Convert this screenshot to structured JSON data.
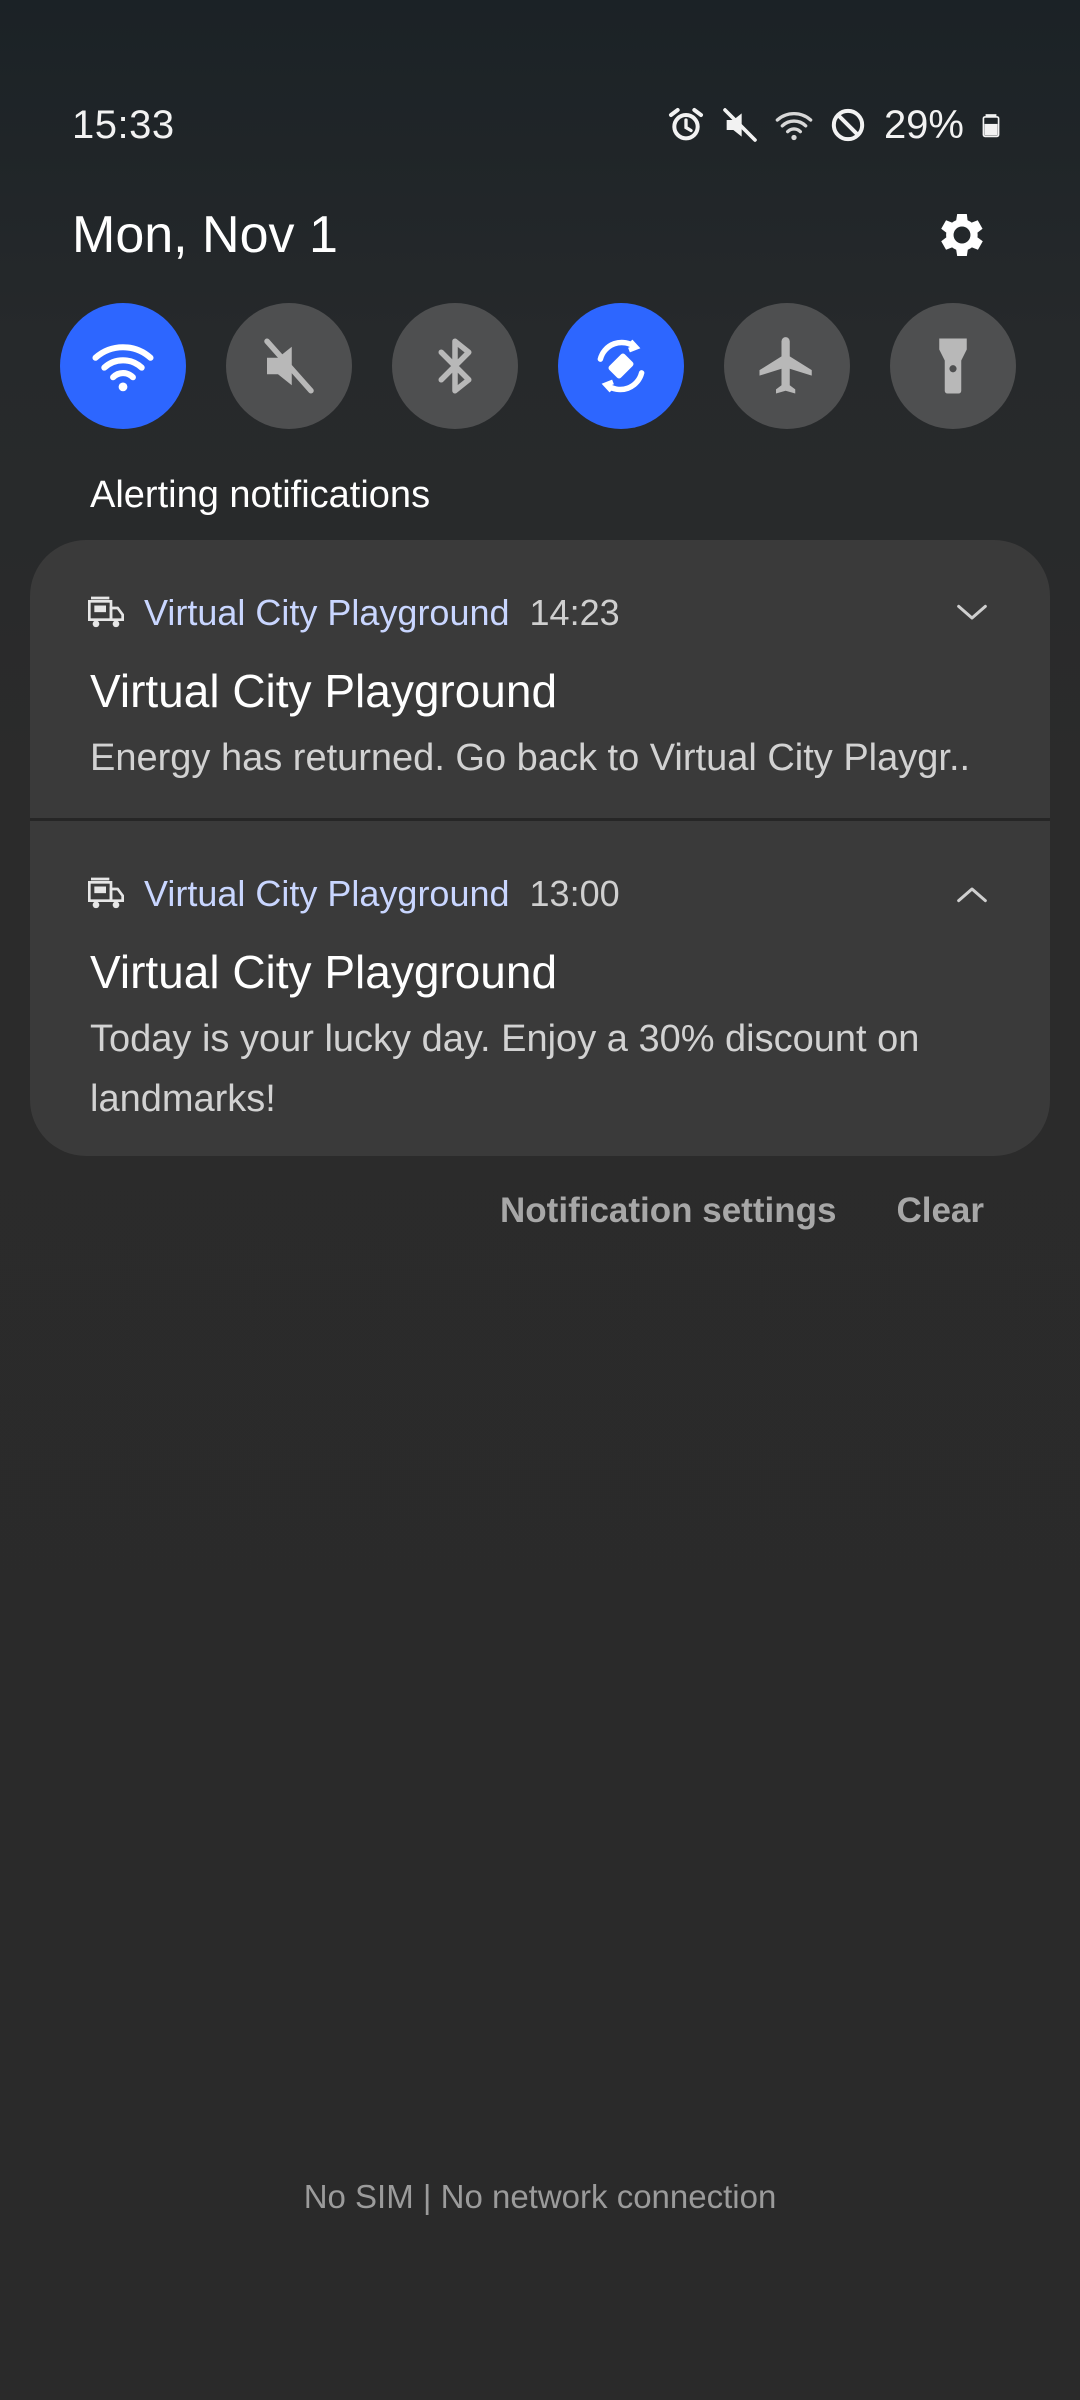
{
  "status_bar": {
    "time": "15:33",
    "battery_percent": "29%",
    "icons": [
      "alarm-icon",
      "mute-icon",
      "wifi-icon",
      "do-not-disturb-icon",
      "battery-icon"
    ]
  },
  "header": {
    "date": "Mon, Nov 1",
    "settings_icon": "gear-icon"
  },
  "quick_settings": [
    {
      "name": "wifi",
      "icon": "wifi-icon",
      "active": true
    },
    {
      "name": "sound",
      "icon": "mute-icon",
      "active": false
    },
    {
      "name": "bluetooth",
      "icon": "bluetooth-icon",
      "active": false
    },
    {
      "name": "auto-rotate",
      "icon": "auto-rotate-icon",
      "active": true
    },
    {
      "name": "airplane-mode",
      "icon": "airplane-icon",
      "active": false
    },
    {
      "name": "flashlight",
      "icon": "flashlight-icon",
      "active": false
    }
  ],
  "section_label": "Alerting notifications",
  "notifications": [
    {
      "app_name": "Virtual City Playground",
      "time": "14:23",
      "title": "Virtual City Playground",
      "body": "Energy has returned. Go back to Virtual City Playgr..",
      "expanded": false
    },
    {
      "app_name": "Virtual City Playground",
      "time": "13:00",
      "title": "Virtual City Playground",
      "body": "Today is your lucky day. Enjoy a 30% discount on landmarks!",
      "expanded": true
    }
  ],
  "actions": {
    "notification_settings": "Notification settings",
    "clear": "Clear"
  },
  "carrier_text": "No SIM | No network connection",
  "colors": {
    "accent": "#2d66ff",
    "tile_inactive": "#4e4f50",
    "card": "#3a3a3a",
    "app_name": "#c9d6ff"
  }
}
